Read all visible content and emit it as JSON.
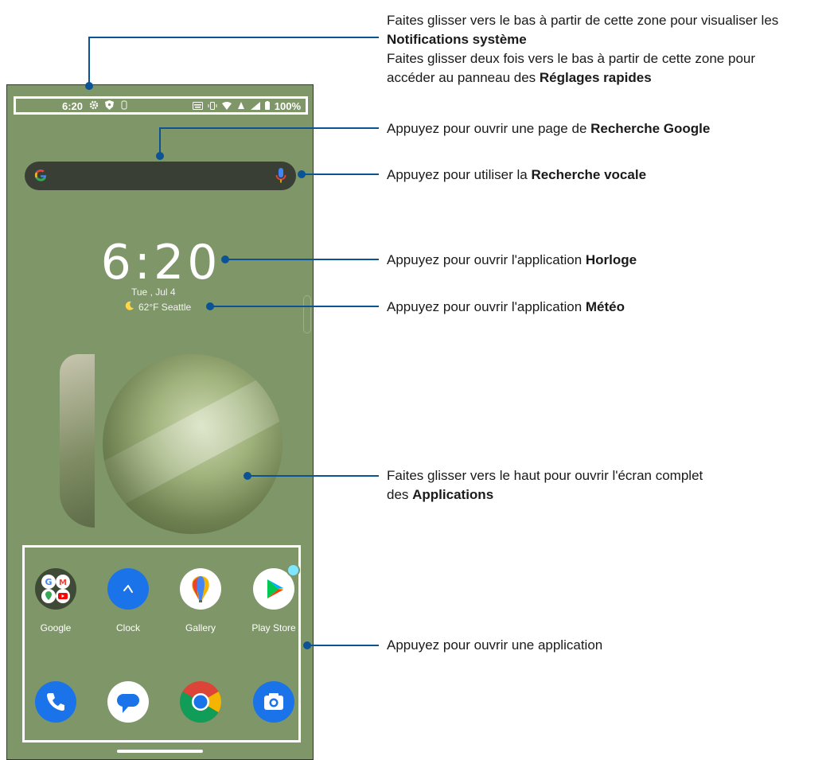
{
  "phone": {
    "status_bar": {
      "time": "6:20",
      "battery": "100%"
    },
    "clock_widget": {
      "time": "6:20",
      "date": "Tue , Jul 4",
      "weather": "62°F  Seattle"
    },
    "apps": [
      {
        "label": "Google"
      },
      {
        "label": "Clock"
      },
      {
        "label": "Gallery"
      },
      {
        "label": "Play Store"
      }
    ],
    "dock": [
      {
        "icon": "phone-icon"
      },
      {
        "icon": "messages-icon"
      },
      {
        "icon": "chrome-icon"
      },
      {
        "icon": "camera-icon"
      }
    ]
  },
  "callouts": {
    "notifications_line1": "Faites glisser vers le bas à partir de cette zone pour visualiser les",
    "notifications_bold": "Notifications système",
    "quick_settings_line1": "Faites glisser deux fois vers le bas à partir de cette zone pour",
    "quick_settings_pre": "accéder au panneau des ",
    "quick_settings_bold": "Réglages rapides",
    "google_pre": "Appuyez pour ouvrir une page de ",
    "google_bold": "Recherche Google",
    "voice_pre": "Appuyez pour utiliser la ",
    "voice_bold": "Recherche vocale",
    "clock_pre": "Appuyez pour ouvrir l'application ",
    "clock_bold": "Horloge",
    "weather_pre": "Appuyez pour ouvrir l'application ",
    "weather_bold": "Météo",
    "apps_line1": "Faites glisser vers le haut pour ouvrir l'écran complet",
    "apps_pre": "des ",
    "apps_bold": "Applications",
    "open_app": "Appuyez pour ouvrir une application"
  },
  "colors": {
    "leader_line": "#0b5394",
    "wallpaper": "#7e9668"
  }
}
